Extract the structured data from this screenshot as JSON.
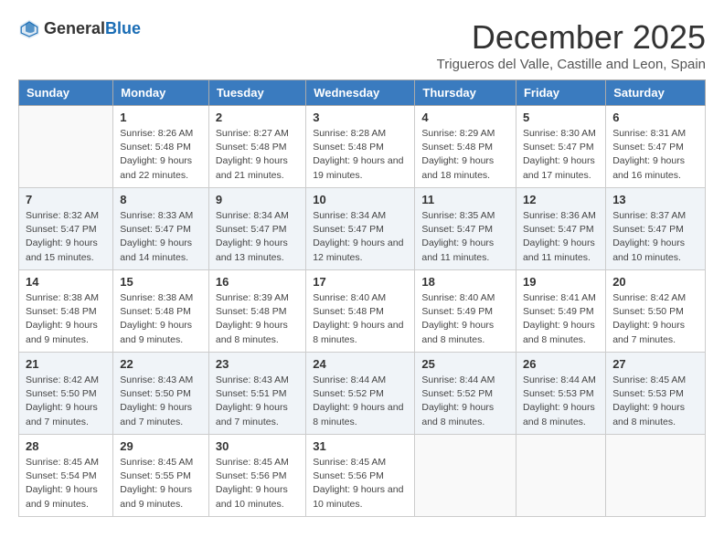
{
  "logo": {
    "text_general": "General",
    "text_blue": "Blue"
  },
  "header": {
    "month": "December 2025",
    "location": "Trigueros del Valle, Castille and Leon, Spain"
  },
  "days_of_week": [
    "Sunday",
    "Monday",
    "Tuesday",
    "Wednesday",
    "Thursday",
    "Friday",
    "Saturday"
  ],
  "weeks": [
    [
      {
        "day": "",
        "sunrise": "",
        "sunset": "",
        "daylight": ""
      },
      {
        "day": "1",
        "sunrise": "Sunrise: 8:26 AM",
        "sunset": "Sunset: 5:48 PM",
        "daylight": "Daylight: 9 hours and 22 minutes."
      },
      {
        "day": "2",
        "sunrise": "Sunrise: 8:27 AM",
        "sunset": "Sunset: 5:48 PM",
        "daylight": "Daylight: 9 hours and 21 minutes."
      },
      {
        "day": "3",
        "sunrise": "Sunrise: 8:28 AM",
        "sunset": "Sunset: 5:48 PM",
        "daylight": "Daylight: 9 hours and 19 minutes."
      },
      {
        "day": "4",
        "sunrise": "Sunrise: 8:29 AM",
        "sunset": "Sunset: 5:48 PM",
        "daylight": "Daylight: 9 hours and 18 minutes."
      },
      {
        "day": "5",
        "sunrise": "Sunrise: 8:30 AM",
        "sunset": "Sunset: 5:47 PM",
        "daylight": "Daylight: 9 hours and 17 minutes."
      },
      {
        "day": "6",
        "sunrise": "Sunrise: 8:31 AM",
        "sunset": "Sunset: 5:47 PM",
        "daylight": "Daylight: 9 hours and 16 minutes."
      }
    ],
    [
      {
        "day": "7",
        "sunrise": "Sunrise: 8:32 AM",
        "sunset": "Sunset: 5:47 PM",
        "daylight": "Daylight: 9 hours and 15 minutes."
      },
      {
        "day": "8",
        "sunrise": "Sunrise: 8:33 AM",
        "sunset": "Sunset: 5:47 PM",
        "daylight": "Daylight: 9 hours and 14 minutes."
      },
      {
        "day": "9",
        "sunrise": "Sunrise: 8:34 AM",
        "sunset": "Sunset: 5:47 PM",
        "daylight": "Daylight: 9 hours and 13 minutes."
      },
      {
        "day": "10",
        "sunrise": "Sunrise: 8:34 AM",
        "sunset": "Sunset: 5:47 PM",
        "daylight": "Daylight: 9 hours and 12 minutes."
      },
      {
        "day": "11",
        "sunrise": "Sunrise: 8:35 AM",
        "sunset": "Sunset: 5:47 PM",
        "daylight": "Daylight: 9 hours and 11 minutes."
      },
      {
        "day": "12",
        "sunrise": "Sunrise: 8:36 AM",
        "sunset": "Sunset: 5:47 PM",
        "daylight": "Daylight: 9 hours and 11 minutes."
      },
      {
        "day": "13",
        "sunrise": "Sunrise: 8:37 AM",
        "sunset": "Sunset: 5:47 PM",
        "daylight": "Daylight: 9 hours and 10 minutes."
      }
    ],
    [
      {
        "day": "14",
        "sunrise": "Sunrise: 8:38 AM",
        "sunset": "Sunset: 5:48 PM",
        "daylight": "Daylight: 9 hours and 9 minutes."
      },
      {
        "day": "15",
        "sunrise": "Sunrise: 8:38 AM",
        "sunset": "Sunset: 5:48 PM",
        "daylight": "Daylight: 9 hours and 9 minutes."
      },
      {
        "day": "16",
        "sunrise": "Sunrise: 8:39 AM",
        "sunset": "Sunset: 5:48 PM",
        "daylight": "Daylight: 9 hours and 8 minutes."
      },
      {
        "day": "17",
        "sunrise": "Sunrise: 8:40 AM",
        "sunset": "Sunset: 5:48 PM",
        "daylight": "Daylight: 9 hours and 8 minutes."
      },
      {
        "day": "18",
        "sunrise": "Sunrise: 8:40 AM",
        "sunset": "Sunset: 5:49 PM",
        "daylight": "Daylight: 9 hours and 8 minutes."
      },
      {
        "day": "19",
        "sunrise": "Sunrise: 8:41 AM",
        "sunset": "Sunset: 5:49 PM",
        "daylight": "Daylight: 9 hours and 8 minutes."
      },
      {
        "day": "20",
        "sunrise": "Sunrise: 8:42 AM",
        "sunset": "Sunset: 5:50 PM",
        "daylight": "Daylight: 9 hours and 7 minutes."
      }
    ],
    [
      {
        "day": "21",
        "sunrise": "Sunrise: 8:42 AM",
        "sunset": "Sunset: 5:50 PM",
        "daylight": "Daylight: 9 hours and 7 minutes."
      },
      {
        "day": "22",
        "sunrise": "Sunrise: 8:43 AM",
        "sunset": "Sunset: 5:50 PM",
        "daylight": "Daylight: 9 hours and 7 minutes."
      },
      {
        "day": "23",
        "sunrise": "Sunrise: 8:43 AM",
        "sunset": "Sunset: 5:51 PM",
        "daylight": "Daylight: 9 hours and 7 minutes."
      },
      {
        "day": "24",
        "sunrise": "Sunrise: 8:44 AM",
        "sunset": "Sunset: 5:52 PM",
        "daylight": "Daylight: 9 hours and 8 minutes."
      },
      {
        "day": "25",
        "sunrise": "Sunrise: 8:44 AM",
        "sunset": "Sunset: 5:52 PM",
        "daylight": "Daylight: 9 hours and 8 minutes."
      },
      {
        "day": "26",
        "sunrise": "Sunrise: 8:44 AM",
        "sunset": "Sunset: 5:53 PM",
        "daylight": "Daylight: 9 hours and 8 minutes."
      },
      {
        "day": "27",
        "sunrise": "Sunrise: 8:45 AM",
        "sunset": "Sunset: 5:53 PM",
        "daylight": "Daylight: 9 hours and 8 minutes."
      }
    ],
    [
      {
        "day": "28",
        "sunrise": "Sunrise: 8:45 AM",
        "sunset": "Sunset: 5:54 PM",
        "daylight": "Daylight: 9 hours and 9 minutes."
      },
      {
        "day": "29",
        "sunrise": "Sunrise: 8:45 AM",
        "sunset": "Sunset: 5:55 PM",
        "daylight": "Daylight: 9 hours and 9 minutes."
      },
      {
        "day": "30",
        "sunrise": "Sunrise: 8:45 AM",
        "sunset": "Sunset: 5:56 PM",
        "daylight": "Daylight: 9 hours and 10 minutes."
      },
      {
        "day": "31",
        "sunrise": "Sunrise: 8:45 AM",
        "sunset": "Sunset: 5:56 PM",
        "daylight": "Daylight: 9 hours and 10 minutes."
      },
      {
        "day": "",
        "sunrise": "",
        "sunset": "",
        "daylight": ""
      },
      {
        "day": "",
        "sunrise": "",
        "sunset": "",
        "daylight": ""
      },
      {
        "day": "",
        "sunrise": "",
        "sunset": "",
        "daylight": ""
      }
    ]
  ]
}
